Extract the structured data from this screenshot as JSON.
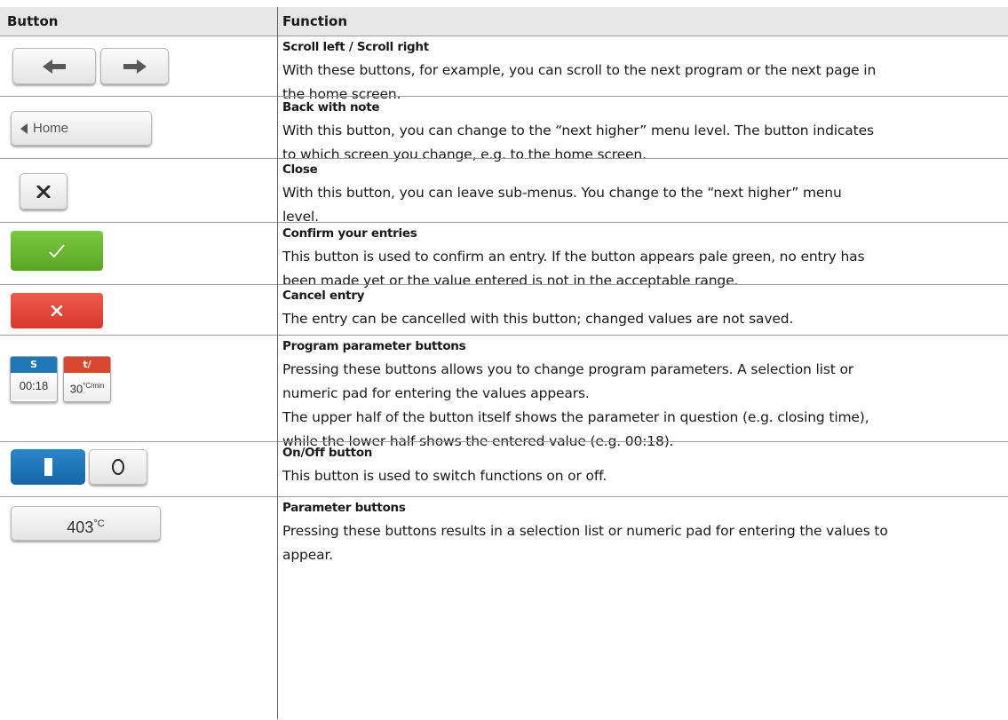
{
  "header": {
    "col_button": "Button",
    "col_function": "Function"
  },
  "rows": [
    {
      "title": "Scroll left / Scroll right",
      "lines": [
        "With these buttons, for example, you can scroll to the next program or the next page in",
        "the home screen."
      ]
    },
    {
      "title": "Back with note",
      "button_label": "Home",
      "lines": [
        "With this button, you can change to the “next higher” menu level. The button indicates",
        "to which screen you change, e.g. to the home screen."
      ]
    },
    {
      "title": "Close",
      "lines": [
        "With this button, you can leave sub-menus. You change to the “next higher” menu",
        "level."
      ]
    },
    {
      "title": "Confirm your entries",
      "lines": [
        "This button is used to confirm an entry. If the button appears pale green, no entry has",
        "been made yet or the value entered is not in the acceptable range."
      ]
    },
    {
      "title": "Cancel entry",
      "lines": [
        "The entry can be cancelled with this button; changed values are not saved."
      ]
    },
    {
      "title": "Program parameter buttons",
      "param_s": {
        "label": "S",
        "value": "00:18",
        "color": "#1e78b8"
      },
      "param_t": {
        "label": "t/",
        "value": "30",
        "unit": "°C/min",
        "color": "#d9472f"
      },
      "lines": [
        "Pressing these buttons allows you to change program parameters. A selection list or",
        "numeric pad for entering the values appears.",
        "The upper half of the button itself shows the parameter in question (e.g. closing time),",
        "while the lower half shows the entered value (e.g. 00:18)."
      ]
    },
    {
      "title": "On/Off button",
      "lines": [
        "This button is used to switch functions on or off."
      ]
    },
    {
      "title": "Parameter buttons",
      "temp_value": "403",
      "temp_unit": "°C",
      "lines": [
        "Pressing these buttons results in a selection list or numeric pad for entering the values to",
        "appear."
      ]
    }
  ],
  "colors": {
    "header_bg": "#e6e6e6",
    "confirm": "#6cb833",
    "cancel": "#e2483a",
    "on": "#1e72b8"
  }
}
